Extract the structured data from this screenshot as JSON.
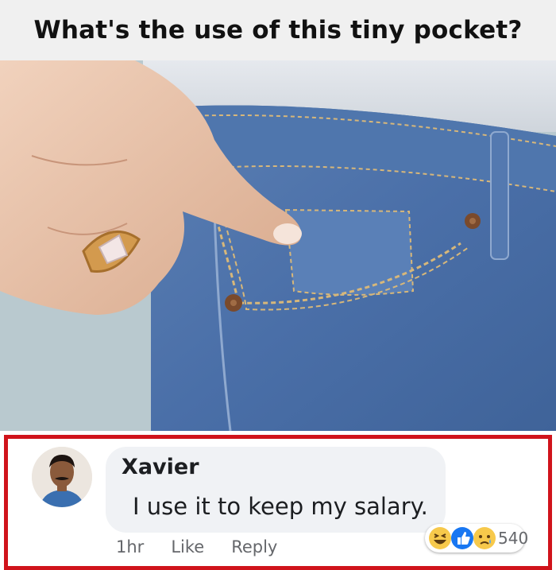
{
  "header": {
    "title": "What's the use of this tiny pocket?"
  },
  "comment": {
    "author": "Xavier",
    "text": "I use it to keep my salary.",
    "time": "1hr",
    "like_label": "Like",
    "reply_label": "Reply",
    "reactions": [
      "haha",
      "like",
      "sad"
    ],
    "reaction_count": "540"
  },
  "colors": {
    "highlight_border": "#d0131b",
    "bubble_bg": "#f0f2f5",
    "like_blue": "#1877f2",
    "emoji_yellow": "#f7c94b"
  }
}
